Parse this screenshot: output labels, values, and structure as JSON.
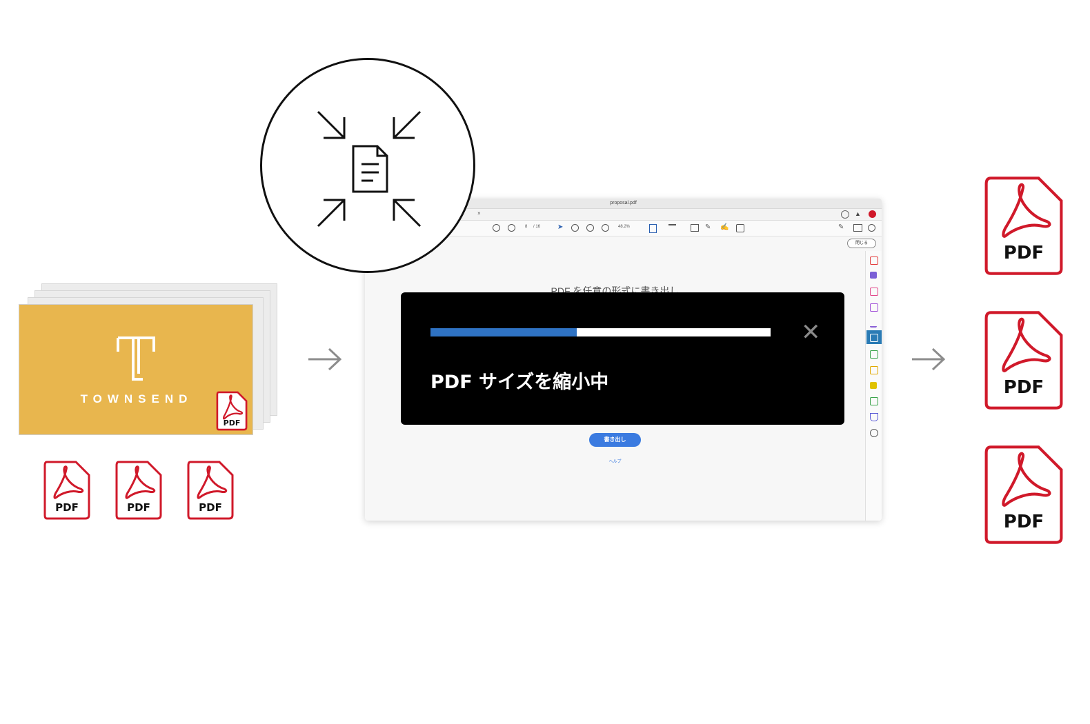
{
  "source": {
    "brand_name": "TOWNSEND",
    "file_badge_label": "PDF",
    "pdf_files": [
      {
        "label": "PDF"
      },
      {
        "label": "PDF"
      },
      {
        "label": "PDF"
      }
    ]
  },
  "compress_badge": {
    "icon": "compress-document-icon"
  },
  "app_window": {
    "title": "proposal.pdf",
    "page_current": "8",
    "page_total": "/ 16",
    "zoom": "48.2%",
    "close_button_label": "閉じる",
    "heading": "PDF を任意の形式に書き出し",
    "export_button_label": "書き出し",
    "help_link_label": "ヘルプ"
  },
  "progress_dialog": {
    "message": "PDF サイズを縮小中",
    "progress": 0.43,
    "close_icon": "close-icon"
  },
  "output": {
    "pdf_files": [
      {
        "label": "PDF"
      },
      {
        "label": "PDF"
      },
      {
        "label": "PDF"
      }
    ]
  },
  "colors": {
    "accent_blue": "#2f73c4",
    "pdf_red": "#d0192a",
    "cover_yellow": "#e8b64e"
  }
}
